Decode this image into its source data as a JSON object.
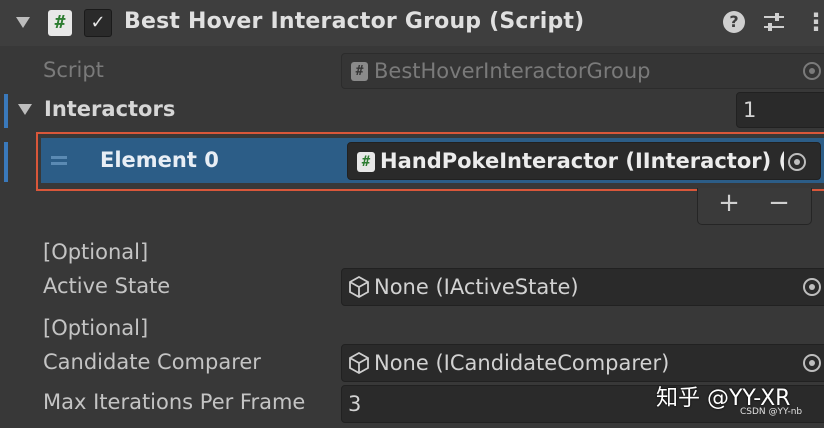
{
  "header": {
    "title": "Best Hover Interactor Group (Script)",
    "enabled_check": "✓",
    "script_icon_glyph": "#",
    "help_icon_glyph": "?",
    "more_icon_glyph": "⋮"
  },
  "script_field": {
    "label": "Script",
    "value": "BestHoverInteractorGroup"
  },
  "interactors": {
    "label": "Interactors",
    "count": "1",
    "elements": [
      {
        "label": "Element 0",
        "value": "HandPokeInteractor (IInteractor) ("
      }
    ],
    "add_label": "+",
    "remove_label": "−"
  },
  "active_state": {
    "optional_tag": "[Optional]",
    "label": "Active State",
    "value": "None (IActiveState)"
  },
  "candidate_comparer": {
    "optional_tag": "[Optional]",
    "label": "Candidate Comparer",
    "value": "None (ICandidateComparer)"
  },
  "max_iterations": {
    "label": "Max Iterations Per Frame",
    "value": "3"
  },
  "watermark": {
    "main": "知乎 @YY-XR",
    "small": "CSDN @YY-nb"
  },
  "colors": {
    "selection": "#2c5d87",
    "highlight_box": "#d9573a",
    "left_bar": "#3a79bb"
  }
}
